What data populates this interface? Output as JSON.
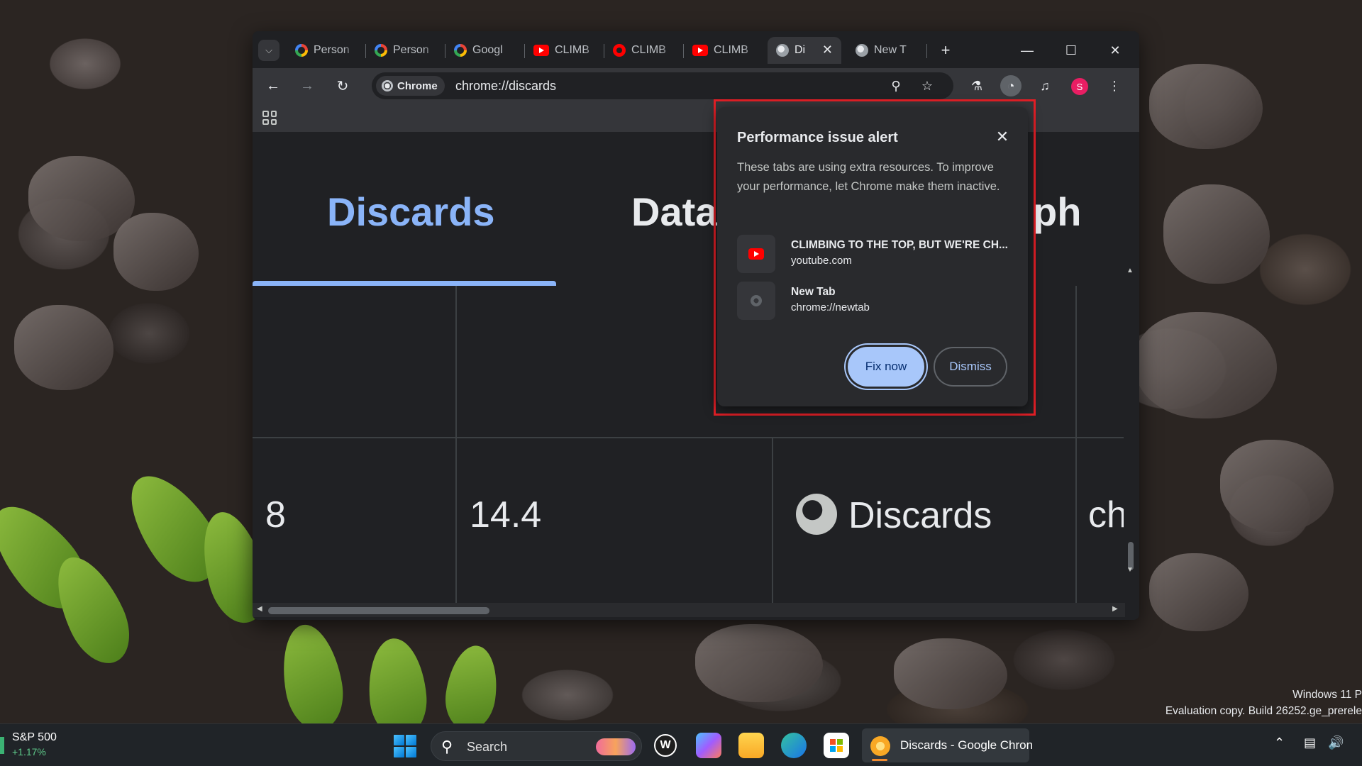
{
  "browser": {
    "tabs": [
      {
        "label": "Person",
        "icon": "google-icon"
      },
      {
        "label": "Person",
        "icon": "google-icon"
      },
      {
        "label": "Googl",
        "icon": "google-icon"
      },
      {
        "label": "CLIMB",
        "icon": "youtube-icon"
      },
      {
        "label": "CLIMB",
        "icon": "youtube-recording-icon"
      },
      {
        "label": "CLIMB",
        "icon": "youtube-icon"
      },
      {
        "label": "Di",
        "icon": "globe-icon",
        "active": true
      },
      {
        "label": "New T",
        "icon": "chrome-icon"
      }
    ],
    "omnibox": {
      "chip_label": "Chrome",
      "url": "chrome://discards"
    },
    "avatar_initial": "S"
  },
  "page": {
    "tabs": [
      "Discards",
      "Data",
      "ph"
    ],
    "row_values": [
      "8",
      "14.4",
      "Discards",
      "ch"
    ]
  },
  "alert": {
    "title": "Performance issue alert",
    "body": "These tabs are using extra resources. To improve your performance, let Chrome make them inactive.",
    "items": [
      {
        "title": "CLIMBING TO THE TOP, BUT WE'RE CH...",
        "url": "youtube.com",
        "icon": "youtube-icon"
      },
      {
        "title": "New Tab",
        "url": "chrome://newtab",
        "icon": "chrome-icon"
      }
    ],
    "primary_button": "Fix now",
    "secondary_button": "Dismiss",
    "highlight_color": "#e21f26"
  },
  "watermark": {
    "line1": "Windows 11 P",
    "line2": "Evaluation copy. Build 26252.ge_prerele"
  },
  "taskbar": {
    "stock_name": "S&P 500",
    "stock_change": "+1.17%",
    "search_placeholder": "Search",
    "running_app_label": "Discards - Google Chron"
  }
}
